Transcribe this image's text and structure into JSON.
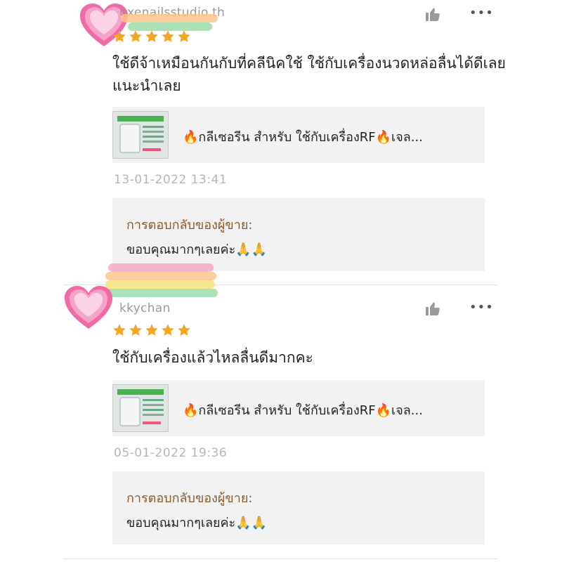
{
  "colors": {
    "star": "#f5a623",
    "reply_heading": "#8a5a2b",
    "timestamp": "#b6b6b6",
    "card_bg": "#f2f2f2",
    "heart_outer": "#f06aa8",
    "heart_inner": "#fbd3e6",
    "rainbow": [
      "#f7a8c5",
      "#fbc58a",
      "#f5e27a",
      "#9fdcab"
    ]
  },
  "icons": {
    "avatar": "heart-icon",
    "star": "star-icon",
    "like": "thumbs-up-icon",
    "more": "more-options-icon",
    "product": "product-thumbnail"
  },
  "reviews": [
    {
      "username": "uxenailsstudio.th",
      "rating": 5,
      "text": "ใช้ดีจ้าเหมือนกันกับที่คลีนิคใช้ ใช้กับเครื่องนวดหล่อลื่นได้ดีเลยแนะนำเลย",
      "product_name": "🔥กลีเซอรีน สำหรับ ใช้กับเครื่องRF🔥เจล...",
      "timestamp": "13-01-2022 13:41",
      "reply_heading": "การตอบกลับของผู้ขาย:",
      "reply_text": "ขอบคุณมากๆเลยค่ะ🙏🙏",
      "more_label": "•••"
    },
    {
      "username": "kkychan",
      "rating": 5,
      "text": "ใช้กับเครื่องแล้วไหลลื่นดีมากคะ",
      "product_name": "🔥กลีเซอรีน สำหรับ ใช้กับเครื่องRF🔥เจล...",
      "timestamp": "05-01-2022 19:36",
      "reply_heading": "การตอบกลับของผู้ขาย:",
      "reply_text": "ขอบคุณมากๆเลยค่ะ🙏🙏",
      "more_label": "•••"
    }
  ]
}
